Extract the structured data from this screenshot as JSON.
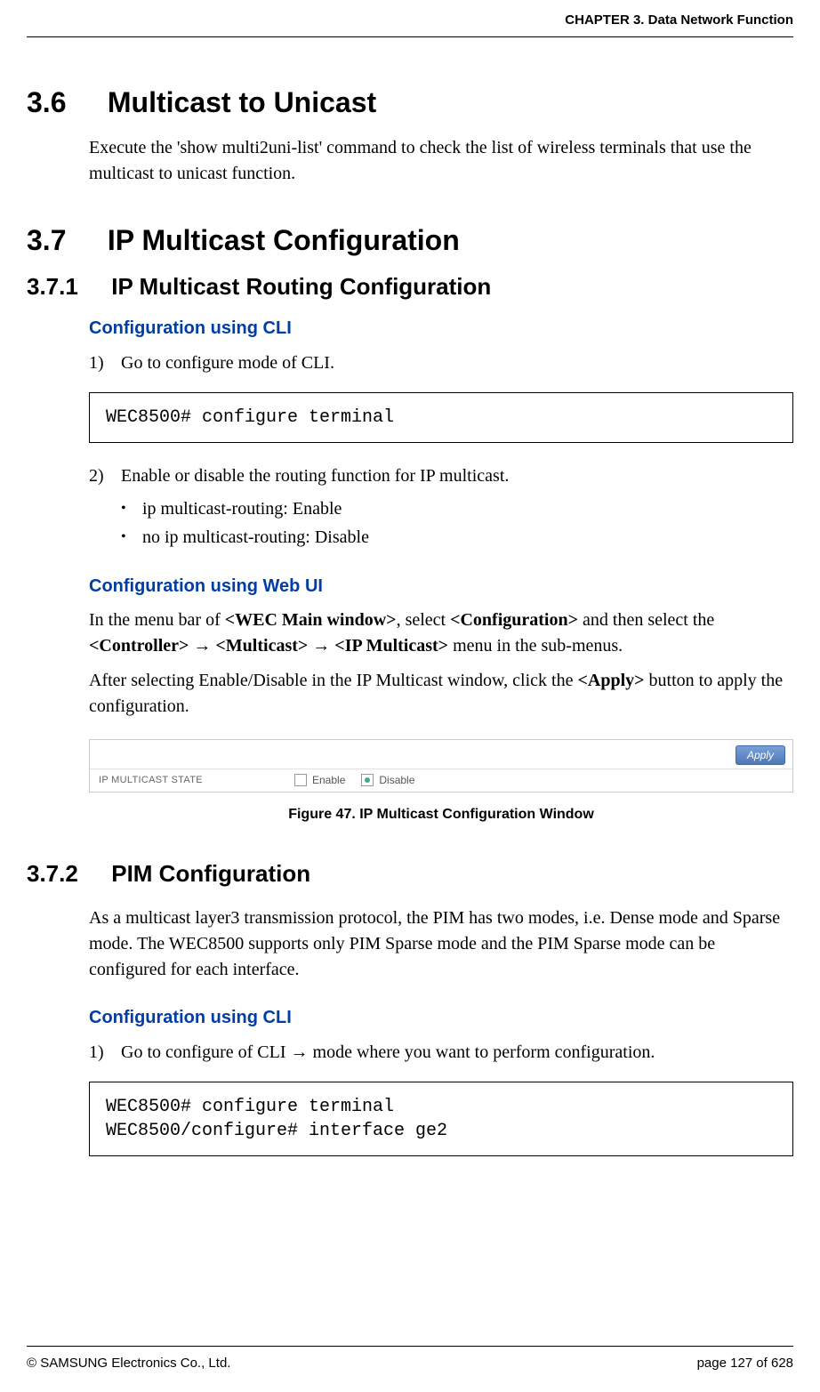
{
  "header": {
    "chapter": "CHAPTER 3. Data Network Function"
  },
  "sec36": {
    "num": "3.6",
    "title": "Multicast to Unicast",
    "para": "Execute the 'show multi2uni-list' command to check the list of wireless terminals that use the multicast to unicast function."
  },
  "sec37": {
    "num": "3.7",
    "title": "IP Multicast Configuration"
  },
  "sec371": {
    "num": "3.7.1",
    "title": "IP Multicast Routing Configuration",
    "cli_h": "Configuration using CLI",
    "step1_num": "1)",
    "step1_txt": "Go to configure mode of CLI.",
    "code1": "WEC8500# configure terminal",
    "step2_num": "2)",
    "step2_txt": "Enable or disable the routing function for IP multicast.",
    "bullet1": "ip multicast-routing: Enable",
    "bullet2": "no ip multicast-routing: Disable",
    "web_h": "Configuration using Web UI",
    "web_p1a": "In the menu bar of ",
    "web_p1b": "<WEC Main window>",
    "web_p1c": ", select ",
    "web_p1d": "<Configuration>",
    "web_p1e": " and then select the ",
    "web_p1f": "<Controller>",
    "web_p1g": " → ",
    "web_p1h": "<Multicast>",
    "web_p1i": " → ",
    "web_p1j": "<IP Multicast>",
    "web_p1k": " menu in the sub-menus.",
    "web_p2a": "After selecting Enable/Disable in the IP Multicast window, click the ",
    "web_p2b": "<Apply>",
    "web_p2c": " button to apply the configuration.",
    "figure": {
      "apply_label": "Apply",
      "row_label": "IP MULTICAST STATE",
      "enable_label": "Enable",
      "disable_label": "Disable",
      "caption": "Figure 47. IP Multicast Configuration Window"
    }
  },
  "sec372": {
    "num": "3.7.2",
    "title": "PIM Configuration",
    "para": "As a multicast layer3 transmission protocol, the PIM has two modes, i.e. Dense mode and Sparse mode. The WEC8500 supports only PIM Sparse mode and the PIM Sparse mode can be configured for each interface.",
    "cli_h": "Configuration using CLI",
    "step1_num": "1)",
    "step1_txt": "Go to configure of CLI → mode where you want to perform configuration.",
    "code1": "WEC8500# configure terminal\nWEC8500/configure# interface ge2"
  },
  "footer": {
    "copyright": "© SAMSUNG Electronics Co., Ltd.",
    "page": "page 127 of 628"
  }
}
